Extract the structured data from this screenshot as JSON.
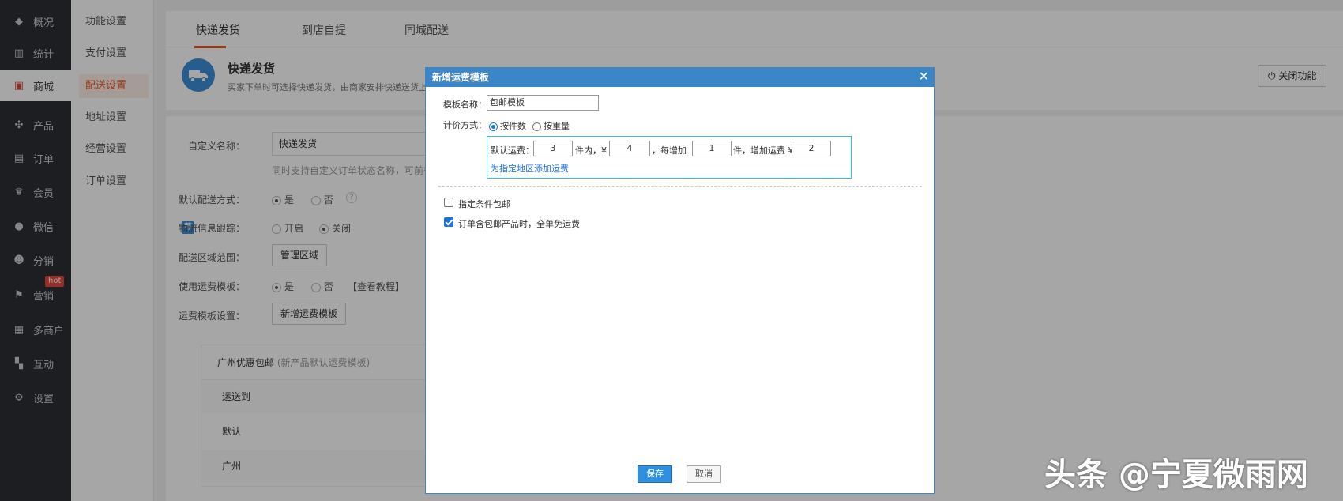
{
  "nav": [
    {
      "label": "概况",
      "icon": "layers-icon"
    },
    {
      "label": "统计",
      "icon": "chart-icon"
    },
    {
      "label": "商城",
      "icon": "shop-icon"
    },
    {
      "label": "产品",
      "icon": "product-icon"
    },
    {
      "label": "订单",
      "icon": "order-icon"
    },
    {
      "label": "会员",
      "icon": "member-icon"
    },
    {
      "label": "微信",
      "icon": "wechat-icon"
    },
    {
      "label": "分销",
      "icon": "distribution-icon"
    },
    {
      "label": "营销",
      "icon": "flag-icon"
    },
    {
      "label": "多商户",
      "icon": "merchants-icon"
    },
    {
      "label": "互动",
      "icon": "interaction-icon"
    },
    {
      "label": "设置",
      "icon": "settings-icon"
    }
  ],
  "hot_badge": "hot",
  "submenu": [
    "功能设置",
    "支付设置",
    "配送设置",
    "地址设置",
    "经营设置",
    "订单设置"
  ],
  "tabs": [
    "快递发货",
    "到店自提",
    "同城配送"
  ],
  "header": {
    "title": "快递发货",
    "desc": "买家下单时可选择快递发货，由商家安排快递送货上",
    "close_feature": "关闭功能"
  },
  "form": {
    "custom_name_label": "自定义名称：",
    "custom_name_value": "快递发货",
    "custom_name_hint": "同时支持自定义订单状态名称，可前往",
    "default_method_label": "默认配送方式：",
    "yes": "是",
    "no": "否",
    "help": "?",
    "logistics_label": "物流信息跟踪：",
    "logistics_badge": "荐",
    "open": "开启",
    "close": "关闭",
    "area_label": "配送区域范围：",
    "area_button": "管理区域",
    "use_template_label": "使用运费模板：",
    "tutorial": "【查看教程】",
    "template_setting_label": "运费模板设置：",
    "new_template_button": "新增运费模板"
  },
  "template_box": {
    "title": "广州优惠包邮",
    "subtitle": "(新产品默认运费模板)",
    "rows": [
      "运送到",
      "默认",
      "广州"
    ]
  },
  "modal": {
    "title": "新增运费模板",
    "close": "✕",
    "name_label": "模板名称：",
    "name_value": "包邮模板",
    "pricing_label": "计价方式：",
    "by_count": "按件数",
    "by_weight": "按重量",
    "default_fee_label": "默认运费：",
    "first_count": "3",
    "within_label": "件内，¥",
    "first_fee": "4",
    "each_add_label": "，每增加",
    "add_count": "1",
    "add_unit_label": "件，增加运费 ¥",
    "add_fee": "2",
    "area_link": "为指定地区添加运费",
    "conditional_free": "指定条件包邮",
    "order_free": "订单含包邮产品时，全单免运费",
    "save": "保存",
    "cancel": "取消"
  },
  "watermark": "头条 @宁夏微雨网"
}
